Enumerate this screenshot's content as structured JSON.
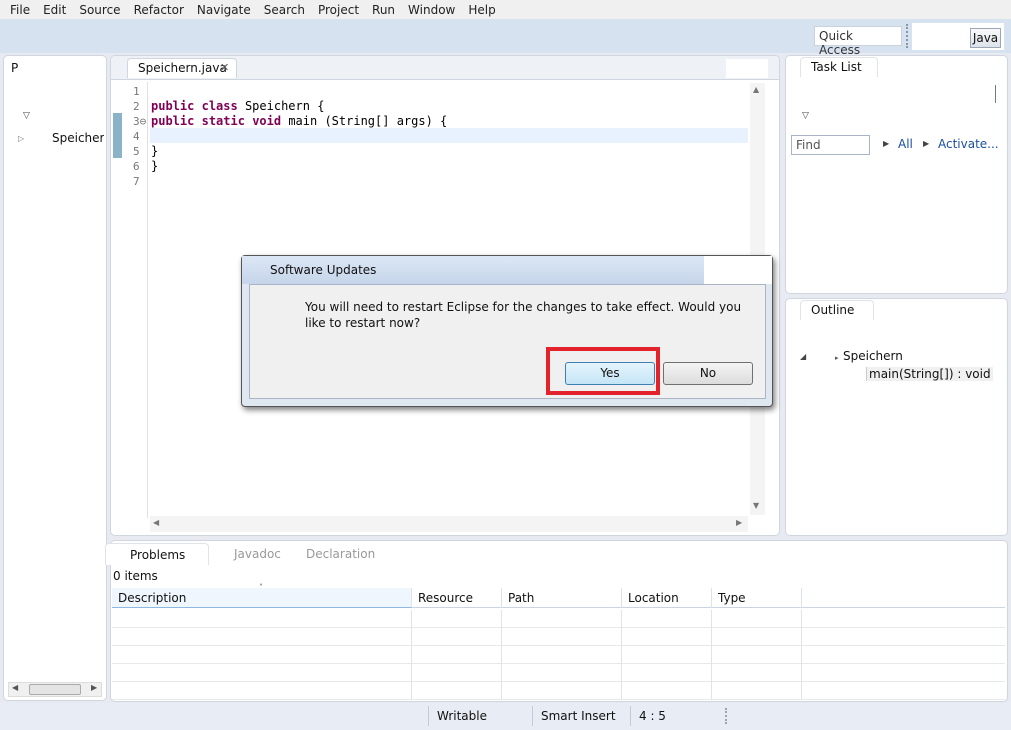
{
  "menu": [
    "File",
    "Edit",
    "Source",
    "Refactor",
    "Navigate",
    "Search",
    "Project",
    "Run",
    "Window",
    "Help"
  ],
  "toolbar": {
    "quick_access": "Quick Access",
    "perspective": "Java"
  },
  "package_explorer": {
    "tab_label": "P",
    "item_label": "Speicher t"
  },
  "editor": {
    "tab_label": "Speichern.java",
    "lines": [
      {
        "n": "1",
        "code": ""
      },
      {
        "n": "2",
        "code": "public class Speichern {"
      },
      {
        "n": "3⊖",
        "code": "public static void main (String[] args) {"
      },
      {
        "n": "4",
        "code": ""
      },
      {
        "n": "5",
        "code": "}"
      },
      {
        "n": "6",
        "code": "}"
      },
      {
        "n": "7",
        "code": ""
      }
    ]
  },
  "task_list": {
    "tab_label": "Task List",
    "find_placeholder": "Find",
    "all_label": "All",
    "activate_label": "Activate..."
  },
  "outline": {
    "tab_label": "Outline",
    "class_label": "Speichern",
    "method_label": "main(String[]) : void"
  },
  "bottom": {
    "tabs": [
      "Problems",
      "Javadoc",
      "Declaration"
    ],
    "count": "0 items",
    "columns": [
      "Description",
      "Resource",
      "Path",
      "Location",
      "Type"
    ]
  },
  "status": {
    "writable": "Writable",
    "insert_mode": "Smart Insert",
    "position": "4 : 5"
  },
  "dialog": {
    "title": "Software Updates",
    "message": "You will need to restart Eclipse for the changes to take effect. Would you like to restart now?",
    "yes_label": "Yes",
    "no_label": "No",
    "highlight_color": "#e3232b"
  }
}
